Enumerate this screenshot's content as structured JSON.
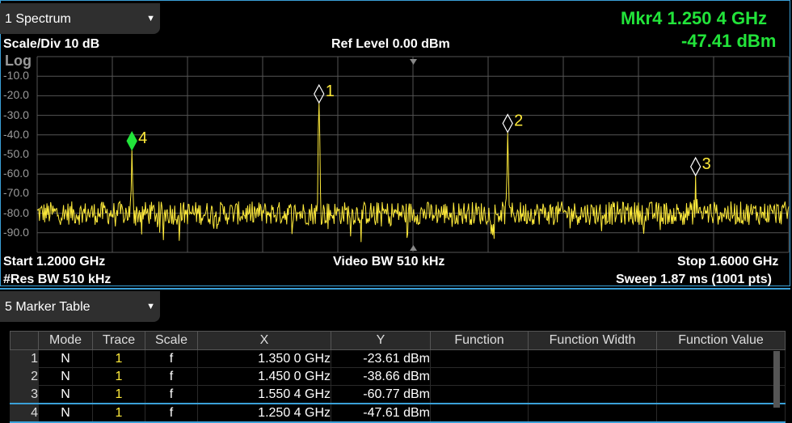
{
  "window": {
    "title": "1 Spectrum"
  },
  "header": {
    "scale_div": "Scale/Div 10 dB",
    "ref_level": "Ref Level 0.00 dBm",
    "scale_type": "Log"
  },
  "active_marker": {
    "label": "Mkr4  1.250 4 GHz",
    "value": "-47.41 dBm",
    "color": "#22e43a"
  },
  "footer": {
    "start": "Start 1.2000 GHz",
    "video_bw": "Video BW 510 kHz",
    "stop": "Stop 1.6000 GHz",
    "res_bw": "#Res BW 510 kHz",
    "sweep": "Sweep 1.87 ms (1001 pts)"
  },
  "chart_data": {
    "type": "line",
    "xlabel": "",
    "ylabel": "",
    "xlim": [
      1.2,
      1.6
    ],
    "ylim": [
      -100,
      0
    ],
    "y_ticks": [
      "-10.0",
      "-20.0",
      "-30.0",
      "-40.0",
      "-50.0",
      "-60.0",
      "-70.0",
      "-80.0",
      "-90.0"
    ],
    "grid": true,
    "trace_color": "#ffeb3b",
    "noise_floor_dbm": -80,
    "peaks": [
      {
        "x": 1.35,
        "y": -23.61,
        "label": "1"
      },
      {
        "x": 1.4504,
        "y": -38.66,
        "label": "2"
      },
      {
        "x": 1.5504,
        "y": -60.77,
        "label": "3"
      },
      {
        "x": 1.2504,
        "y": -47.61,
        "label": "4"
      }
    ]
  },
  "marker_table": {
    "title": "5 Marker Table",
    "columns": [
      "Mode",
      "Trace",
      "Scale",
      "X",
      "Y",
      "Function",
      "Function Width",
      "Function Value"
    ],
    "rows": [
      {
        "n": "1",
        "mode": "N",
        "trace": "1",
        "scale": "f",
        "x": "1.350 0 GHz",
        "y": "-23.61 dBm",
        "function": "",
        "function_width": "",
        "function_value": ""
      },
      {
        "n": "2",
        "mode": "N",
        "trace": "1",
        "scale": "f",
        "x": "1.450 0 GHz",
        "y": "-38.66 dBm",
        "function": "",
        "function_width": "",
        "function_value": ""
      },
      {
        "n": "3",
        "mode": "N",
        "trace": "1",
        "scale": "f",
        "x": "1.550 4 GHz",
        "y": "-60.77 dBm",
        "function": "",
        "function_width": "",
        "function_value": ""
      },
      {
        "n": "4",
        "mode": "N",
        "trace": "1",
        "scale": "f",
        "x": "1.250 4 GHz",
        "y": "-47.61 dBm",
        "function": "",
        "function_width": "",
        "function_value": ""
      }
    ],
    "selected_row": "4"
  }
}
